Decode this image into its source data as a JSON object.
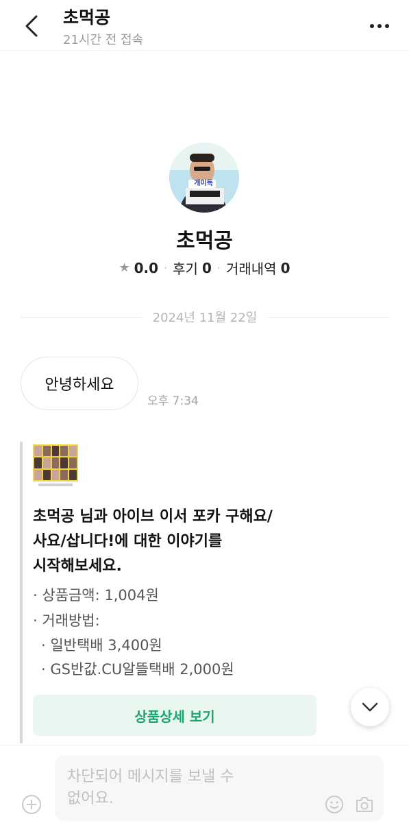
{
  "header": {
    "title": "초먹공",
    "subtitle": "21시간 전 접속"
  },
  "profile": {
    "name": "초먹공",
    "rating": "0.0",
    "reviews_label": "후기",
    "reviews_count": "0",
    "trades_label": "거래내역",
    "trades_count": "0",
    "avatar_caption": "개이득"
  },
  "date_divider": "2024년 11월 22일",
  "messages": [
    {
      "text": "안녕하세요",
      "time": "오후 7:34"
    }
  ],
  "product_card": {
    "title_lines": [
      "초먹공 님과 아이브 이서 포카 구해요/",
      "사요/삽니다!에 대한 이야기를",
      "시작해보세요."
    ],
    "price": "· 상품금액: 1,004원",
    "method_label": "· 거래방법:",
    "methods": [
      "· 일반택배 3,400원",
      "· GS반값.CU알뜰택배 2,000원"
    ],
    "button_label": "상품상세 보기"
  },
  "input": {
    "placeholder_lines": [
      "차단되어 메시지를 보낼 수",
      "없어요."
    ]
  },
  "colors": {
    "accent": "#1aa56b",
    "button_bg": "#e9f7f0"
  }
}
